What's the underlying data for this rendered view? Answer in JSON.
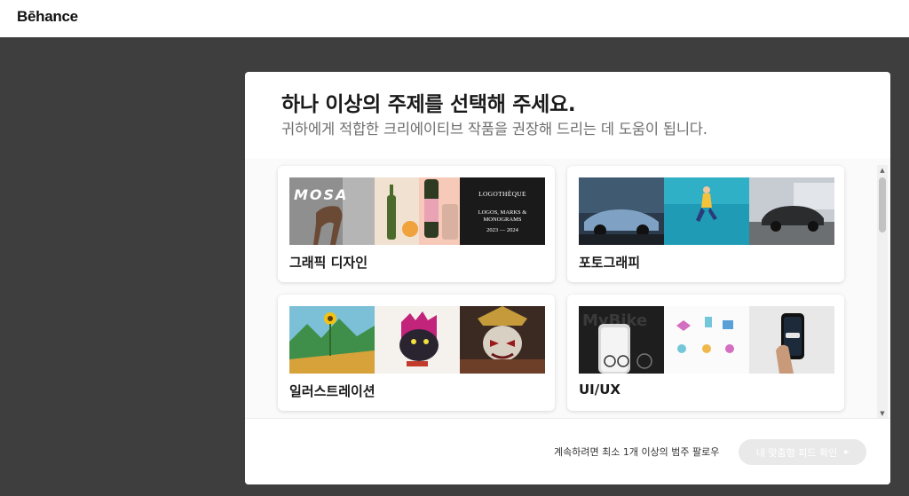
{
  "app": {
    "logo": "Bēhance"
  },
  "modal": {
    "title": "하나 이상의 주제를 선택해 주세요.",
    "subtitle": "귀하에게 적합한 크리에이티브 작품을 권장해 드리는 데 도움이 됩니다.",
    "cards": [
      {
        "label": "그래픽 디자인",
        "thumbs": [
          {
            "text": "MOSA"
          },
          {
            "text": ""
          },
          {
            "title": "LOGOTHÈQUE",
            "lines": "LOGOS, MARKS & MONOGRAMS",
            "years": "2023 — 2024"
          }
        ]
      },
      {
        "label": "포토그래피",
        "thumbs": [
          {
            "text": ""
          },
          {
            "text": ""
          },
          {
            "text": ""
          }
        ]
      },
      {
        "label": "일러스트레이션",
        "thumbs": [
          {
            "text": ""
          },
          {
            "text": ""
          },
          {
            "text": ""
          }
        ]
      },
      {
        "label": "UI/UX",
        "thumbs": [
          {
            "text": "MyBike"
          },
          {
            "text": ""
          },
          {
            "text": ""
          }
        ]
      }
    ]
  },
  "footer": {
    "hint": "계속하려면 최소 1개 이상의 범주 팔로우",
    "button_label": "내 맞춤형 피드 확인",
    "button_icon": "chevron-right-icon"
  }
}
